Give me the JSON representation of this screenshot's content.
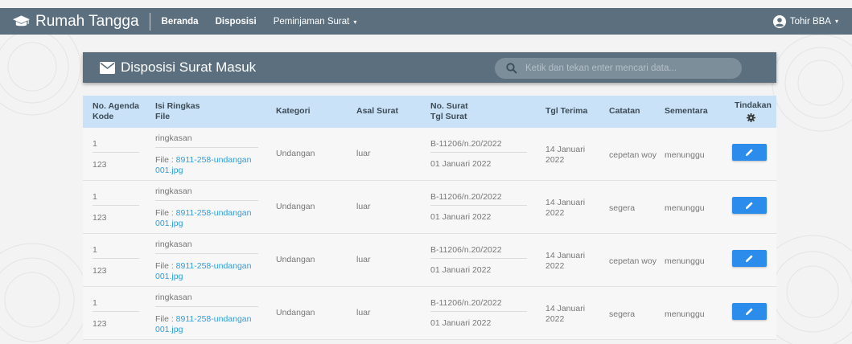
{
  "navbar": {
    "brand": "Rumah Tangga",
    "links": [
      "Beranda",
      "Disposisi"
    ],
    "dropdown_label": "Peminjaman Surat",
    "user_name": "Tohir BBA",
    "caret": "▾",
    "bg_color": "#5b6f7e"
  },
  "panel": {
    "title": "Disposisi Surat Masuk",
    "search_placeholder": "Ketik dan tekan enter mencari data..."
  },
  "table": {
    "headers": {
      "agenda": "No. Agenda",
      "kode": "Kode",
      "isi": "Isi Ringkas",
      "file": "File",
      "kategori": "Kategori",
      "asal": "Asal Surat",
      "no_surat": "No. Surat",
      "tgl_surat": "Tgl Surat",
      "tgl_terima": "Tgl Terima",
      "catatan": "Catatan",
      "sementara": "Sementara",
      "tindakan": "Tindakan"
    },
    "rows": [
      {
        "agenda": "1",
        "kode": "123",
        "isi": "ringkasan",
        "file_prefix": "File : ",
        "file_line1": "8911-258-undangan",
        "file_line2": "001.jpg",
        "kategori": "Undangan",
        "asal": "luar",
        "no_surat": "B-11206/n.20/2022",
        "tgl_surat": "01 Januari 2022",
        "tgl_terima_1": "14 Januari",
        "tgl_terima_2": "2022",
        "catatan": "cepetan woy",
        "sementara": "menunggu"
      },
      {
        "agenda": "1",
        "kode": "123",
        "isi": "ringkasan",
        "file_prefix": "File : ",
        "file_line1": "8911-258-undangan",
        "file_line2": "001.jpg",
        "kategori": "Undangan",
        "asal": "luar",
        "no_surat": "B-11206/n.20/2022",
        "tgl_surat": "01 Januari 2022",
        "tgl_terima_1": "14 Januari",
        "tgl_terima_2": "2022",
        "catatan": "segera",
        "sementara": "menunggu"
      },
      {
        "agenda": "1",
        "kode": "123",
        "isi": "ringkasan",
        "file_prefix": "File : ",
        "file_line1": "8911-258-undangan",
        "file_line2": "001.jpg",
        "kategori": "Undangan",
        "asal": "luar",
        "no_surat": "B-11206/n.20/2022",
        "tgl_surat": "01 Januari 2022",
        "tgl_terima_1": "14 Januari",
        "tgl_terima_2": "2022",
        "catatan": "cepetan woy",
        "sementara": "menunggu"
      },
      {
        "agenda": "1",
        "kode": "123",
        "isi": "ringkasan",
        "file_prefix": "File : ",
        "file_line1": "8911-258-undangan",
        "file_line2": "001.jpg",
        "kategori": "Undangan",
        "asal": "luar",
        "no_surat": "B-11206/n.20/2022",
        "tgl_surat": "01 Januari 2022",
        "tgl_terima_1": "14 Januari",
        "tgl_terima_2": "2022",
        "catatan": "segera",
        "sementara": "menunggu"
      }
    ]
  },
  "colors": {
    "accent": "#2c8cec",
    "link": "#2f9fdc",
    "header_row": "#c9e2f7"
  },
  "icons": {
    "brand": "graduation-cap-icon",
    "user": "user-circle-icon",
    "panel": "envelope-icon",
    "search": "search-icon",
    "settings": "gear-icon",
    "edit": "pencil-icon"
  }
}
